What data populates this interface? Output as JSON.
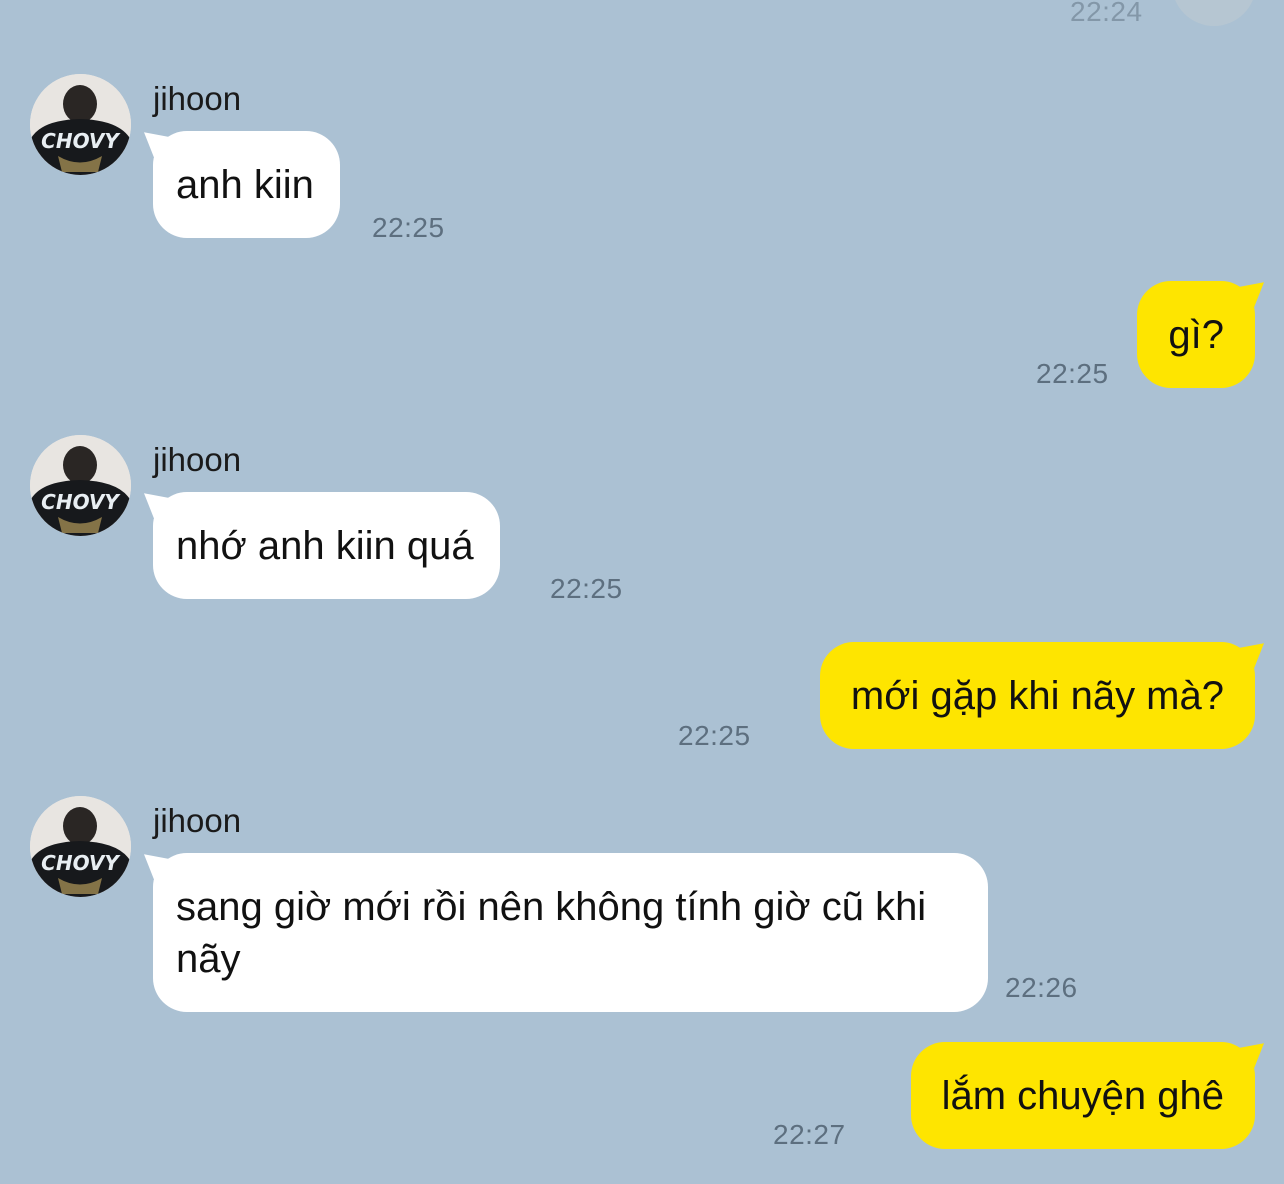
{
  "top": {
    "time": "22:24"
  },
  "messages": [
    {
      "from": "jihoon",
      "name": "jihoon",
      "text": "anh kiin",
      "time": "22:25"
    },
    {
      "from": "me",
      "text": "gì?",
      "time": "22:25"
    },
    {
      "from": "jihoon",
      "name": "jihoon",
      "text": "nhớ anh kiin quá",
      "time": "22:25"
    },
    {
      "from": "me",
      "text": "mới gặp khi nãy mà?",
      "time": "22:25"
    },
    {
      "from": "jihoon",
      "name": "jihoon",
      "text": "sang giờ mới rồi nên không tính giờ cũ khi nãy",
      "time": "22:26"
    },
    {
      "from": "me",
      "text": "lắm chuyện ghê",
      "time": "22:27"
    }
  ],
  "avatar_shirt_text": "CHOVY",
  "colors": {
    "background": "#abc1d3",
    "incoming_bubble": "#ffffff",
    "outgoing_bubble": "#fee500",
    "timestamp": "#5d6f7f"
  }
}
